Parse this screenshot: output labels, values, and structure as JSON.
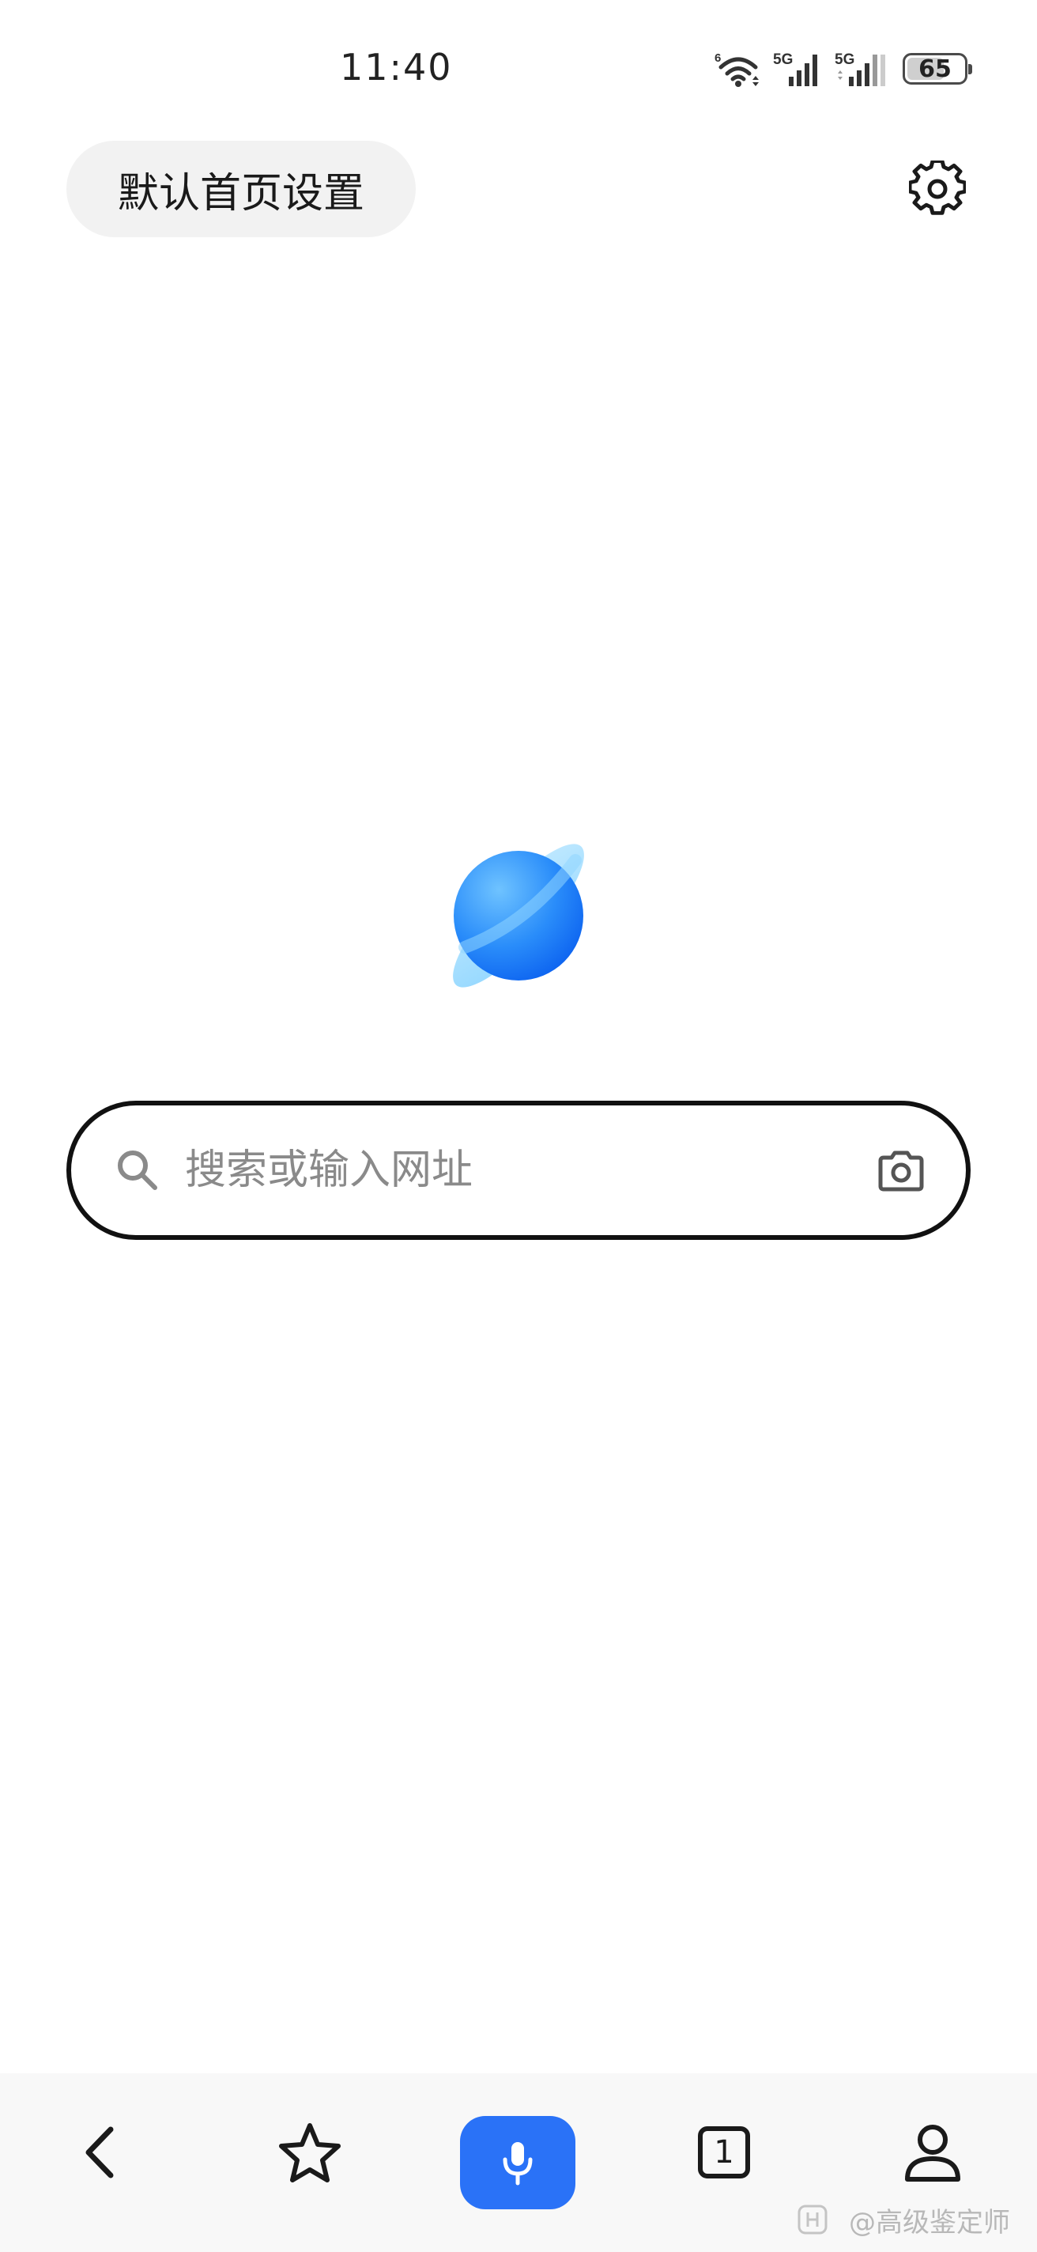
{
  "status_bar": {
    "time": "11:40",
    "wifi_badge": "6",
    "sim1_label": "5G",
    "sim2_label": "5G",
    "battery_level": "65",
    "battery_fraction": 0.65
  },
  "header": {
    "homepage_settings_label": "默认首页设置",
    "settings_icon": "gear-icon"
  },
  "logo": {
    "icon": "planet-logo-icon",
    "color_light": "#6ec3ff",
    "color_dark": "#1570f5"
  },
  "search": {
    "placeholder": "搜索或输入网址",
    "value": "",
    "left_icon": "search-icon",
    "right_icon": "camera-icon"
  },
  "bottom_nav": {
    "back_icon": "chevron-left-icon",
    "bookmark_icon": "star-icon",
    "voice_icon": "microphone-icon",
    "tabs_count": "1",
    "profile_icon": "user-icon",
    "accent": "#2a72f7"
  },
  "watermark": {
    "text": "@高级鉴定师"
  }
}
